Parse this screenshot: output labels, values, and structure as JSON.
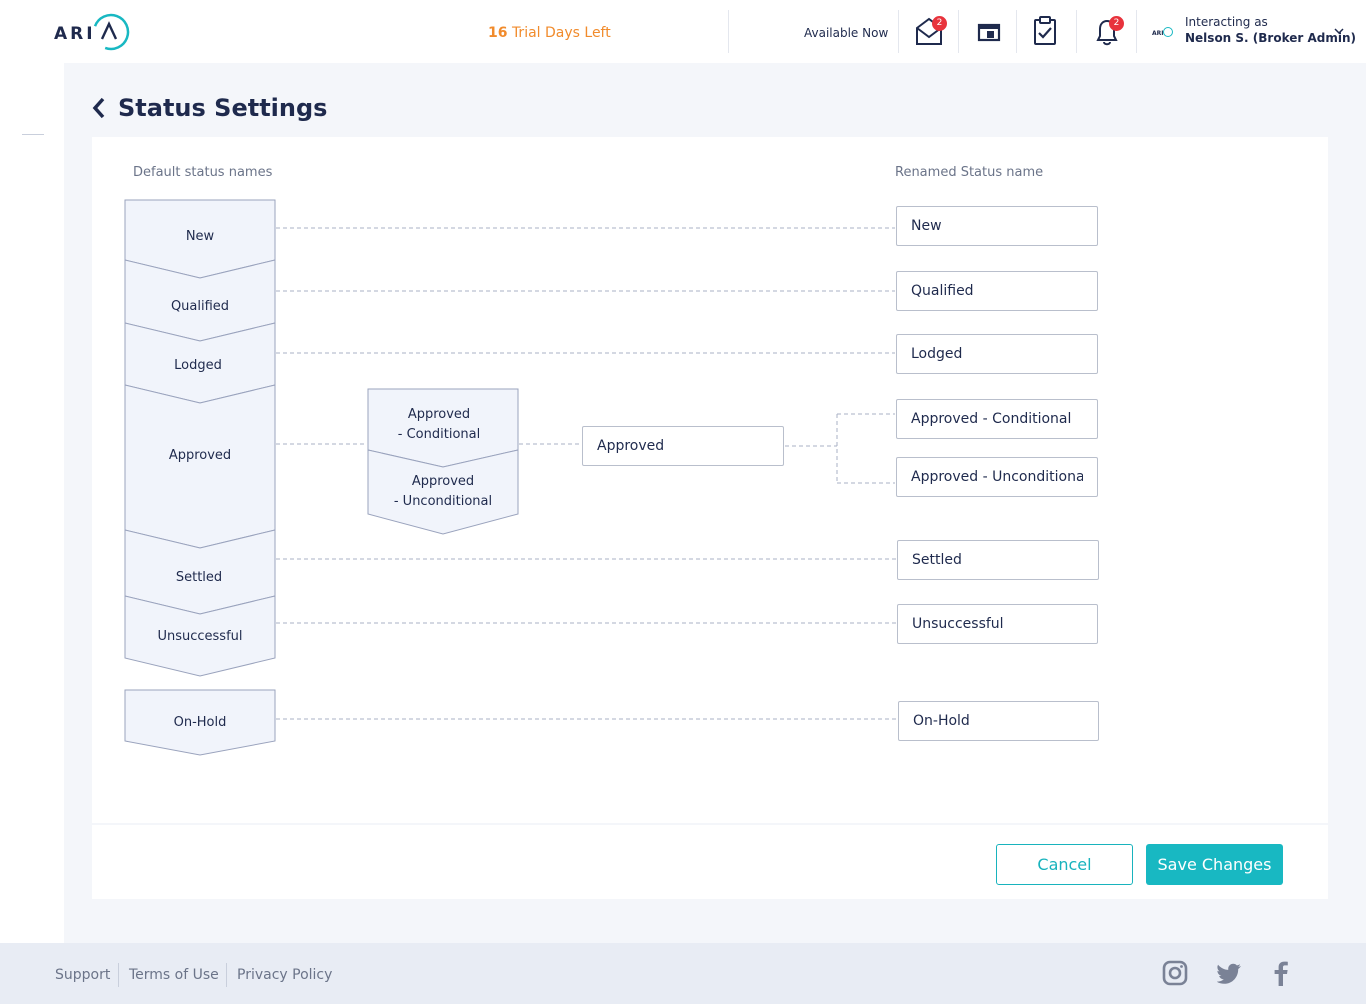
{
  "header": {
    "trial_days": "16",
    "trial_text": "Trial Days Left",
    "availability": "Available Now",
    "messages_badge": "2",
    "notifications_badge": "2",
    "interacting_label": "Interacting as",
    "user_name": "Nelson S. (Broker Admin)",
    "icons": [
      "mail-icon",
      "calendar-icon",
      "tasks-clipboard-icon",
      "bell-icon",
      "chevron-down-icon"
    ]
  },
  "page": {
    "title": "Status Settings"
  },
  "columns": {
    "default_label": "Default status names",
    "renamed_label": "Renamed Status name"
  },
  "default_statuses": {
    "new": "New",
    "qualified": "Qualified",
    "lodged": "Lodged",
    "approved": "Approved",
    "settled": "Settled",
    "unsuccessful": "Unsuccessful",
    "on_hold": "On-Hold"
  },
  "approved_sub": {
    "conditional_line1": "Approved",
    "conditional_line2": "- Conditional",
    "unconditional_line1": "Approved",
    "unconditional_line2": "- Unconditional"
  },
  "group_field": {
    "value": "Approved"
  },
  "renamed": {
    "new": "New",
    "qualified": "Qualified",
    "lodged": "Lodged",
    "approved_conditional": "Approved - Conditional",
    "approved_unconditional": "Approved - Unconditional",
    "settled": "Settled",
    "unsuccessful": "Unsuccessful",
    "on_hold": "On-Hold"
  },
  "actions": {
    "cancel": "Cancel",
    "save": "Save Changes"
  },
  "footer": {
    "support": "Support",
    "terms": "Terms of Use",
    "privacy": "Privacy Policy",
    "social": [
      "instagram-icon",
      "twitter-icon",
      "facebook-icon"
    ]
  },
  "colors": {
    "accent": "#18b8c2",
    "trial": "#f18b2c",
    "badge": "#e8333c",
    "navy": "#1f2a4d",
    "segment_fill": "#f1f4fb",
    "segment_stroke": "#9aa3bd"
  }
}
